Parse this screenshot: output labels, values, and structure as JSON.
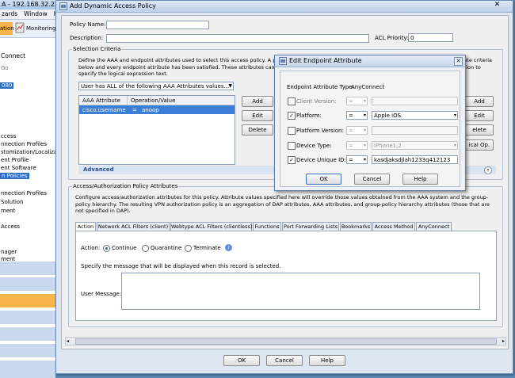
{
  "background_window": {
    "title": "A - 192.168.32.22",
    "menu": [
      "zards",
      "Window",
      "H"
    ],
    "toolbar": [
      "ation",
      "Monitoring"
    ],
    "sidebar_items": [
      "Connect",
      "Go",
      "080",
      "ccess",
      "nnection Profiles",
      "stomization/Localizati",
      "ent Profile",
      "ent Software",
      "n Policies",
      "nnection Profiles",
      "Solution",
      "ment",
      "Access",
      "nager",
      "ment"
    ]
  },
  "dialog": {
    "title": "Add Dynamic Access Policy",
    "policy_name_label": "Policy Name:",
    "policy_name_value": "",
    "description_label": "Description:",
    "description_value": "",
    "acl_priority_label": "ACL Priority:",
    "acl_priority_value": "0",
    "selection_criteria": {
      "legend": "Selection Criteria",
      "text": "Define the AAA and endpoint attributes used to select this access policy. A policy is used when a user's authorization attributes match the AAA attribute criteria below and every endpoint attribute has been satisfied. These attributes can be created using the tables below and/or by expanding the Advanced option to specify the logical expression text.",
      "match_select": "User has ALL of the following AAA Attributes values...",
      "table_headers": [
        "AAA Attribute",
        "Operation/Value"
      ],
      "table_rows": [
        {
          "attribute": "cisco.username",
          "op": "=",
          "value": "anoop"
        }
      ],
      "buttons": [
        "Add",
        "Edit",
        "Delete"
      ],
      "right_buttons": [
        "Add",
        "Edit",
        "elete",
        "ical Op."
      ],
      "advanced_label": "Advanced"
    },
    "policy_attrs": {
      "legend": "Access/Authorization Policy Attributes",
      "text": "Configure access/authorization attributes for this policy. Attribute values specified here will override those values obtained from the AAA system and the group-policy hierarchy. The resulting VPN authorization policy is an aggregation of DAP attributes, AAA attributes, and group-policy hierarchy attributes (those that are not specified in DAP).",
      "tabs": [
        "Action",
        "Network ACL Filters (client)",
        "Webtype ACL Filters (clientless)",
        "Functions",
        "Port Forwarding Lists",
        "Bookmarks",
        "Access Method",
        "AnyConnect"
      ],
      "action_label": "Action:",
      "action_options": [
        "Continue",
        "Quarantine",
        "Terminate"
      ],
      "action_selected": "Continue",
      "message_hint": "Specify the message that will be displayed when this record is selected.",
      "user_message_label": "User Message:",
      "user_message_value": ""
    },
    "footer_buttons": [
      "OK",
      "Cancel",
      "Help"
    ]
  },
  "endpoint_dialog": {
    "title": "Edit Endpoint Attribute",
    "type_label": "Endpoint Attribute Type:",
    "type_value": "AnyConnect",
    "rows": [
      {
        "label": "Client Version:",
        "checked": false,
        "op": "=",
        "value": "",
        "disabled": true
      },
      {
        "label": "Platform:",
        "checked": true,
        "op": "=",
        "value": "Apple iOS",
        "disabled": false
      },
      {
        "label": "Platform Version:",
        "checked": false,
        "op": "=",
        "value": "",
        "disabled": true
      },
      {
        "label": "Device Type:",
        "checked": false,
        "op": "=",
        "value": "iPhone1,2",
        "disabled": true
      },
      {
        "label": "Device Unique ID:",
        "checked": true,
        "op": "=",
        "value": "kasdjaksdjlah1233q412123",
        "disabled": false
      }
    ],
    "buttons": [
      "OK",
      "Cancel",
      "Help"
    ]
  },
  "colors": {
    "accent": "#2a5db0",
    "selected_row": "#3a7ed6",
    "background": "#5b87b4",
    "sidebar_highlight": "#f7b44a"
  }
}
